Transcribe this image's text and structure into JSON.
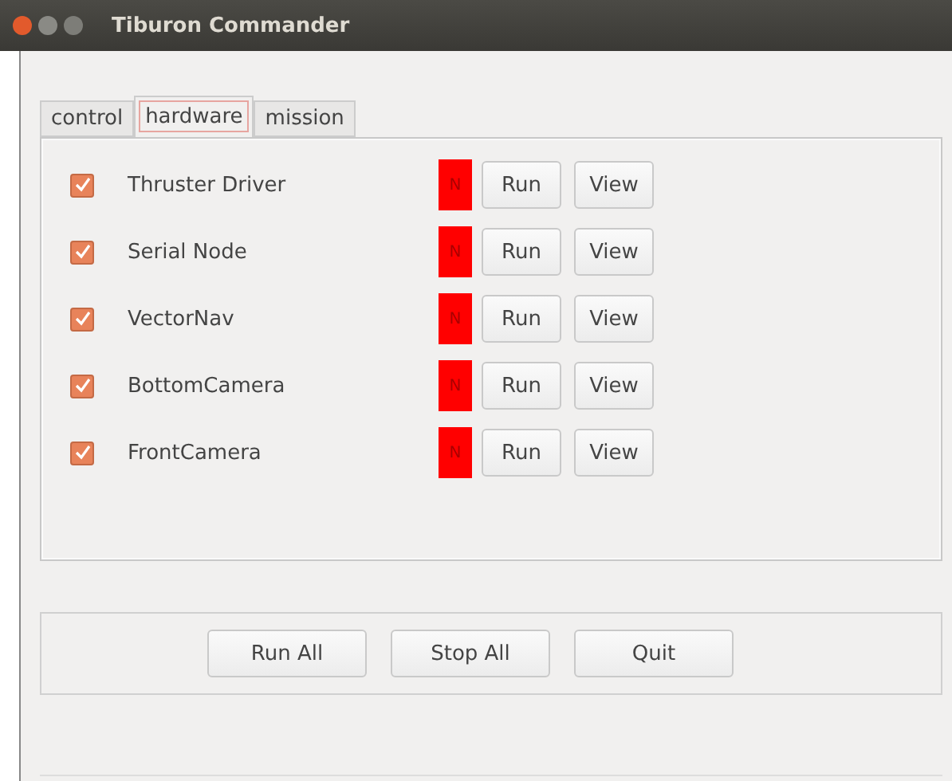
{
  "window": {
    "title": "Tiburon Commander"
  },
  "tabs": [
    {
      "label": "control",
      "selected": false
    },
    {
      "label": "hardware",
      "selected": true
    },
    {
      "label": "mission",
      "selected": false
    }
  ],
  "modules": [
    {
      "name": "Thruster Driver",
      "checked": true,
      "status": "N",
      "color": "#ff0000",
      "run": "Run",
      "view": "View"
    },
    {
      "name": "Serial Node",
      "checked": true,
      "status": "N",
      "color": "#ff0000",
      "run": "Run",
      "view": "View"
    },
    {
      "name": "VectorNav",
      "checked": true,
      "status": "N",
      "color": "#ff0000",
      "run": "Run",
      "view": "View"
    },
    {
      "name": "BottomCamera",
      "checked": true,
      "status": "N",
      "color": "#ff0000",
      "run": "Run",
      "view": "View"
    },
    {
      "name": "FrontCamera",
      "checked": true,
      "status": "N",
      "color": "#ff0000",
      "run": "Run",
      "view": "View"
    }
  ],
  "buttons": [
    "Run All",
    "Stop All",
    "Quit"
  ]
}
